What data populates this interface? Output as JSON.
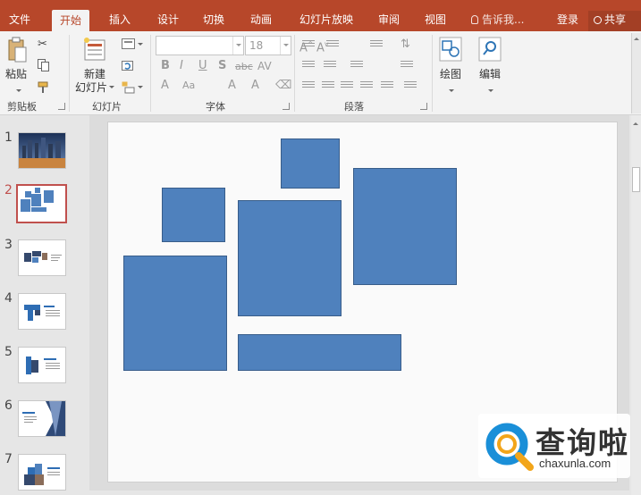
{
  "tabs": [
    "文件",
    "开始",
    "插入",
    "设计",
    "切换",
    "动画",
    "幻灯片放映",
    "审阅",
    "视图"
  ],
  "active_tab": "开始",
  "tell_me": "告诉我...",
  "login": "登录",
  "share": "共享",
  "ribbon": {
    "paste_label": "粘贴",
    "clipboard_group": "剪贴板",
    "new_slide_line1": "新建",
    "new_slide_line2": "幻灯片",
    "slides_group": "幻灯片",
    "font_size": "18",
    "font_group": "字体",
    "paragraph_group": "段落",
    "drawing_label": "绘图",
    "editing_label": "编辑",
    "font_buttons": [
      "B",
      "I",
      "U",
      "S",
      "abc",
      "AV"
    ]
  },
  "slides": [
    {
      "number": "1",
      "thumb": "city-night-photo"
    },
    {
      "number": "2",
      "thumb": "blue-rectangles",
      "selected": true
    },
    {
      "number": "3",
      "thumb": "photo-collage"
    },
    {
      "number": "4",
      "thumb": "layout-blue-text"
    },
    {
      "number": "5",
      "thumb": "layout-photo-text"
    },
    {
      "number": "6",
      "thumb": "layout-triangle-photo"
    },
    {
      "number": "7",
      "thumb": "layout-blue-photo"
    }
  ],
  "colors": {
    "accent": "#b7472a",
    "shape_fill": "#4f81bd",
    "shape_border": "#385d8a",
    "selected_thumb": "#c0504d"
  },
  "watermark": {
    "title": "查询啦",
    "url": "chaxunla.com"
  }
}
